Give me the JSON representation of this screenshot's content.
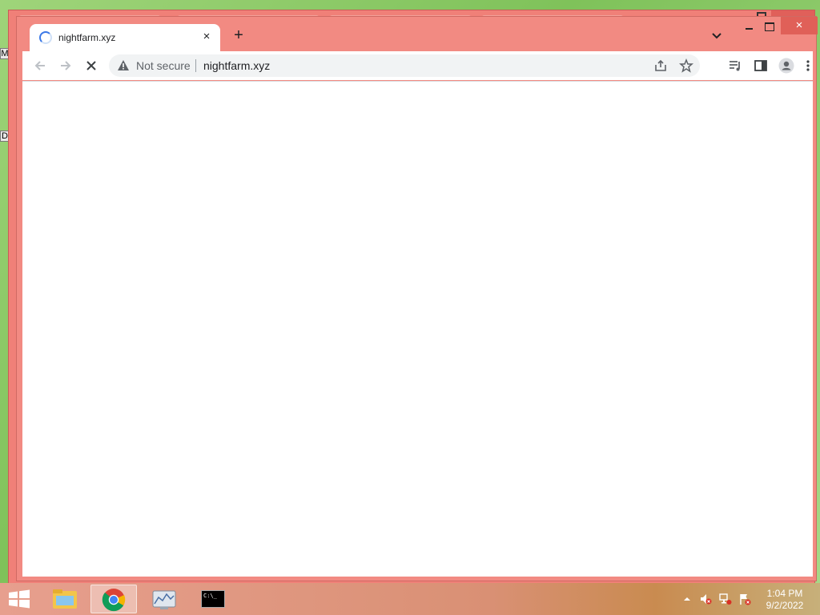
{
  "desktop": {
    "left_glyphs": [
      "M",
      "D"
    ]
  },
  "browser": {
    "tab": {
      "title": "nightfarm.xyz",
      "close_glyph": "×"
    },
    "new_tab_glyph": "+",
    "window_close_glyph": "×",
    "bg_window_close_glyph": "×",
    "toolbar": {
      "back_icon": "arrow-left-icon",
      "forward_icon": "arrow-right-icon",
      "stop_icon": "stop-icon"
    },
    "omnibox": {
      "security_label": "Not secure",
      "url": "nightfarm.xyz"
    }
  },
  "taskbar": {
    "items": [
      "file-explorer",
      "chrome",
      "task-manager",
      "command-prompt"
    ],
    "cmd_label": "C:\\_",
    "clock": {
      "time": "1:04 PM",
      "date": "9/2/2022"
    }
  },
  "colors": {
    "browser_frame": "#f28a82",
    "close_button": "#e06058",
    "spinner": "#3b78e7"
  }
}
